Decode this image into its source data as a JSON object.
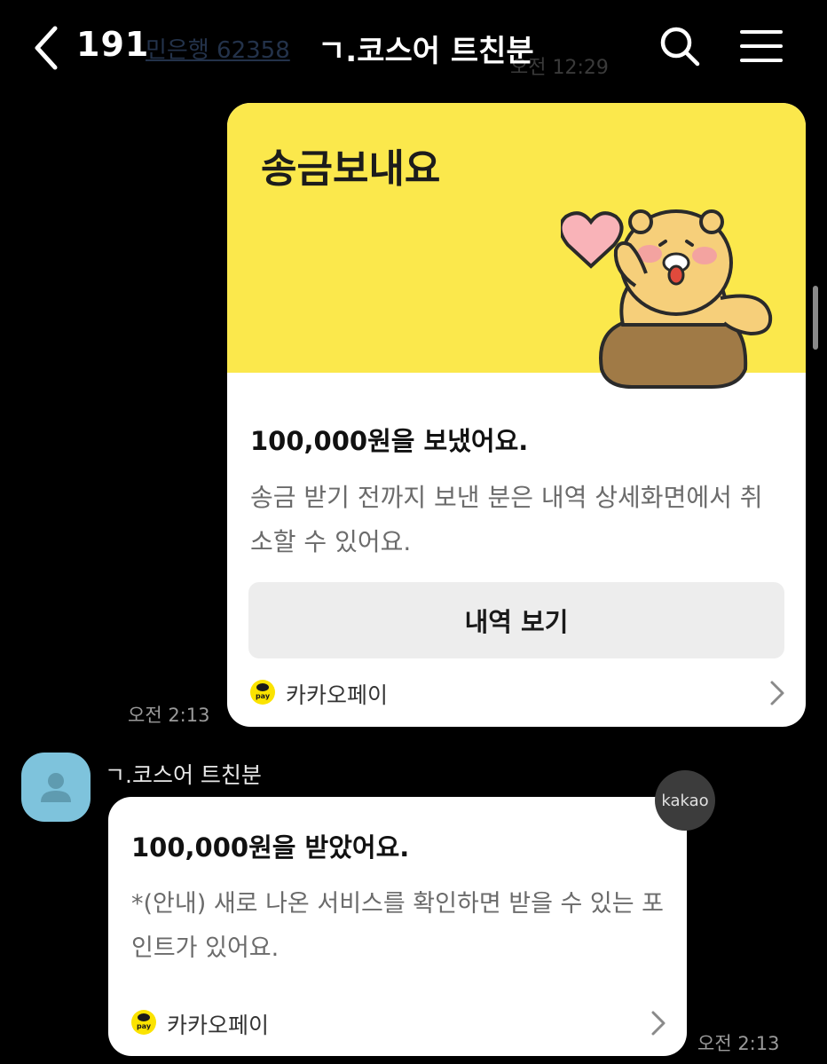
{
  "header": {
    "unread_count": "191",
    "title": "ㄱ.코스어 트친분",
    "ghost_text": "민은행 62358",
    "ghost_time": "오전 12:29"
  },
  "sent_message": {
    "hero_title": "송금보내요",
    "amount_text": "100,000원을 보냈어요.",
    "description": "송금 받기 전까지 보낸 분은 내역 상세화면에서 취소할 수 있어요.",
    "history_button": "내역 보기",
    "service_name": "카카오페이",
    "pay_badge": "pay",
    "time": "오전 2:13"
  },
  "received_message": {
    "sender": "ㄱ.코스어 트친분",
    "badge": "kakao",
    "amount_text": "100,000원을 받았어요.",
    "description": "*(안내) 새로 나온 서비스를 확인하면 받을 수 있는 포인트가 있어요.",
    "service_name": "카카오페이",
    "pay_badge": "pay",
    "time": "오전 2:13"
  },
  "colors": {
    "background": "#000000",
    "card_hero_yellow": "#fbe84c",
    "pay_yellow": "#fbe300",
    "avatar_blue": "#7ec3dc"
  }
}
